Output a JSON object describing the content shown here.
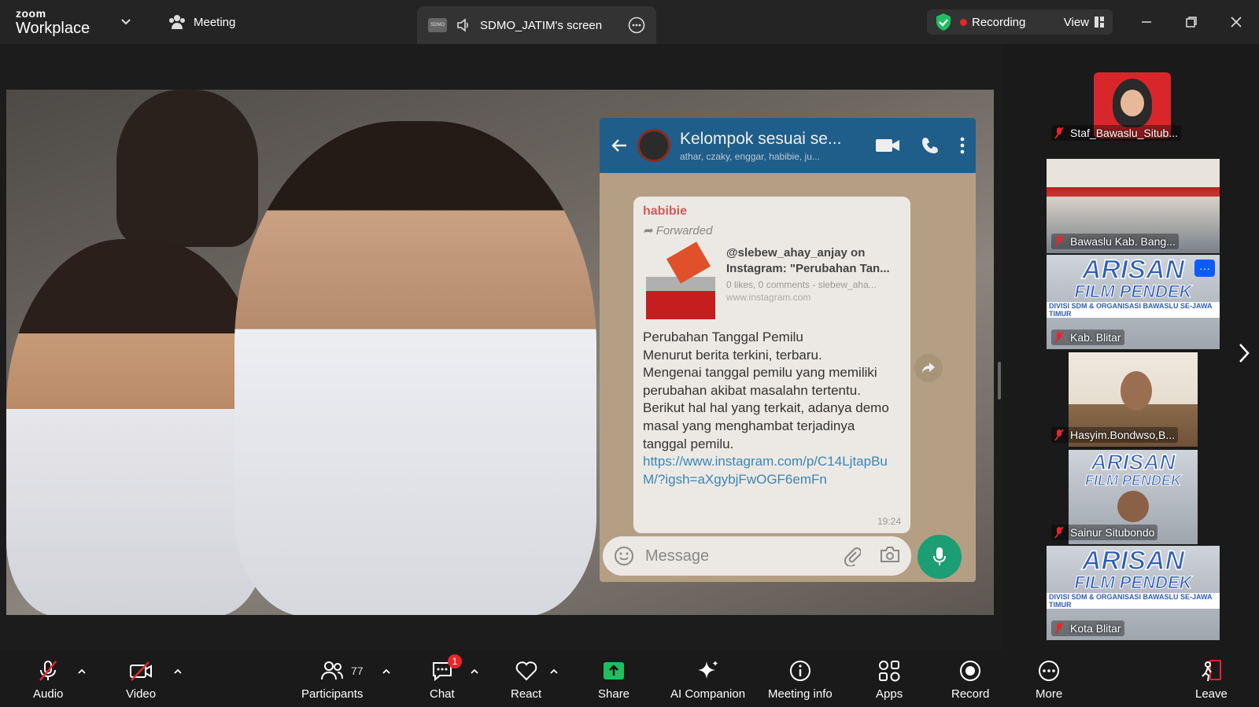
{
  "app": {
    "brand_top": "zoom",
    "brand_bottom": "Workplace"
  },
  "titlebar": {
    "meeting_label": "Meeting",
    "screen_label": "SDMO_JATIM's screen",
    "screen_avatar_text": "SDMO",
    "recording_label": "Recording",
    "view_label": "View"
  },
  "shared": {
    "chat_title": "Kelompok sesuai se...",
    "chat_subtitle": "athar, czaky, enggar, habibie, ju...",
    "sender": "habibie",
    "forwarded": "Forwarded",
    "card_title": "@slebew_ahay_anjay on Instagram: \"Perubahan Tan...",
    "card_meta": "0 likes, 0 comments - slebew_aha...",
    "card_url": "www.instagram.com",
    "body": "Perubahan Tanggal Pemilu\n Menurut berita terkini, terbaru.\nMengenai tanggal pemilu yang memiliki perubahan akibat masalahn tertentu. Berikut hal hal yang terkait, adanya demo masal yang menghambat terjadinya tanggal pemilu.",
    "link": "https://www.instagram.com/p/C14LjtapBuM/?igsh=aXgybjFwOGF6emFn",
    "time": "19:24",
    "message_placeholder": "Message"
  },
  "gallery": {
    "tiles": [
      {
        "name": "Staf_Bawaslu_Situb..."
      },
      {
        "name": "Bawaslu Kab. Bang..."
      },
      {
        "name": "Kab. Blitar",
        "poster_1": "ARISAN",
        "poster_2": "FILM PENDEK",
        "poster_3": "DIVISI SDM & ORGANISASI BAWASLU SE-JAWA TIMUR"
      },
      {
        "name": "Hasyim.Bondwso,B..."
      },
      {
        "name": "Sainur Situbondo",
        "poster_1": "ARISAN",
        "poster_2": "FILM PENDEK"
      },
      {
        "name": "Kota Blitar",
        "poster_1": "ARISAN",
        "poster_2": "FILM PENDEK",
        "poster_3": "DIVISI SDM & ORGANISASI BAWASLU SE-JAWA TIMUR"
      }
    ],
    "more_glyph": "···"
  },
  "toolbar": {
    "audio": "Audio",
    "video": "Video",
    "participants": "Participants",
    "participants_count": "77",
    "chat": "Chat",
    "chat_badge": "1",
    "react": "React",
    "share": "Share",
    "ai": "AI Companion",
    "info": "Meeting info",
    "apps": "Apps",
    "record": "Record",
    "more": "More",
    "leave": "Leave"
  },
  "colors": {
    "recording": "#e8252b",
    "share": "#1fbf5f",
    "leave": "#e8252b",
    "accent": "#0b5cff"
  }
}
